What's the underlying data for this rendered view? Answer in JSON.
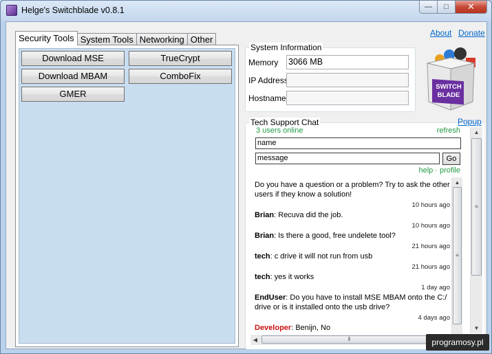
{
  "window": {
    "title": "Helge's Switchblade v0.8.1",
    "controls": {
      "minimize": "—",
      "maximize": "□",
      "close": "✕"
    }
  },
  "tabs": [
    {
      "label": "Security Tools",
      "active": true
    },
    {
      "label": "System Tools",
      "active": false
    },
    {
      "label": "Networking",
      "active": false
    },
    {
      "label": "Other",
      "active": false
    }
  ],
  "security_tools": {
    "download_mse": "Download MSE",
    "truecrypt": "TrueCrypt",
    "download_mbam": "Download MBAM",
    "combofix": "ComboFix",
    "gmer": "GMER"
  },
  "links": {
    "about": "About",
    "donate": "Donate"
  },
  "system_info": {
    "title": "System Information",
    "memory_label": "Memory",
    "memory_value": "3066 MB",
    "ip_label": "IP Address",
    "ip_value": "",
    "hostname_label": "Hostname",
    "hostname_value": ""
  },
  "logo": {
    "line1": "SWITCH",
    "line2": "BLADE"
  },
  "chat": {
    "title": "Tech Support Chat",
    "popup": "Popup",
    "users_online": "3 users online",
    "refresh": "refresh",
    "name_value": "name",
    "message_value": "message",
    "go": "Go",
    "help_profile": "help · profile",
    "intro": "Do you have a question or a problem? Try to ask the other users if they know a solution!",
    "messages": [
      {
        "time": "10 hours ago",
        "user": "Brian",
        "text": "Recuva did the job."
      },
      {
        "time": "10 hours ago",
        "user": "Brian",
        "text": "Is there a good, free undelete tool?"
      },
      {
        "time": "21 hours ago",
        "user": "tech",
        "text": "c drive it will not run from usb"
      },
      {
        "time": "21 hours ago",
        "user": "tech",
        "text": "yes it works"
      },
      {
        "time": "1 day ago",
        "user": "EndUser",
        "text": "Do you have to install MSE MBAM onto the C:/ drive or is it installed onto the usb drive?"
      },
      {
        "time": "4 days ago",
        "user": "Developer",
        "text": "Benijn, No"
      }
    ]
  },
  "watermark": "programosy.pl",
  "colors": {
    "accent_link": "#0066cc",
    "online_green": "#229944",
    "developer_red": "#cc1111"
  }
}
